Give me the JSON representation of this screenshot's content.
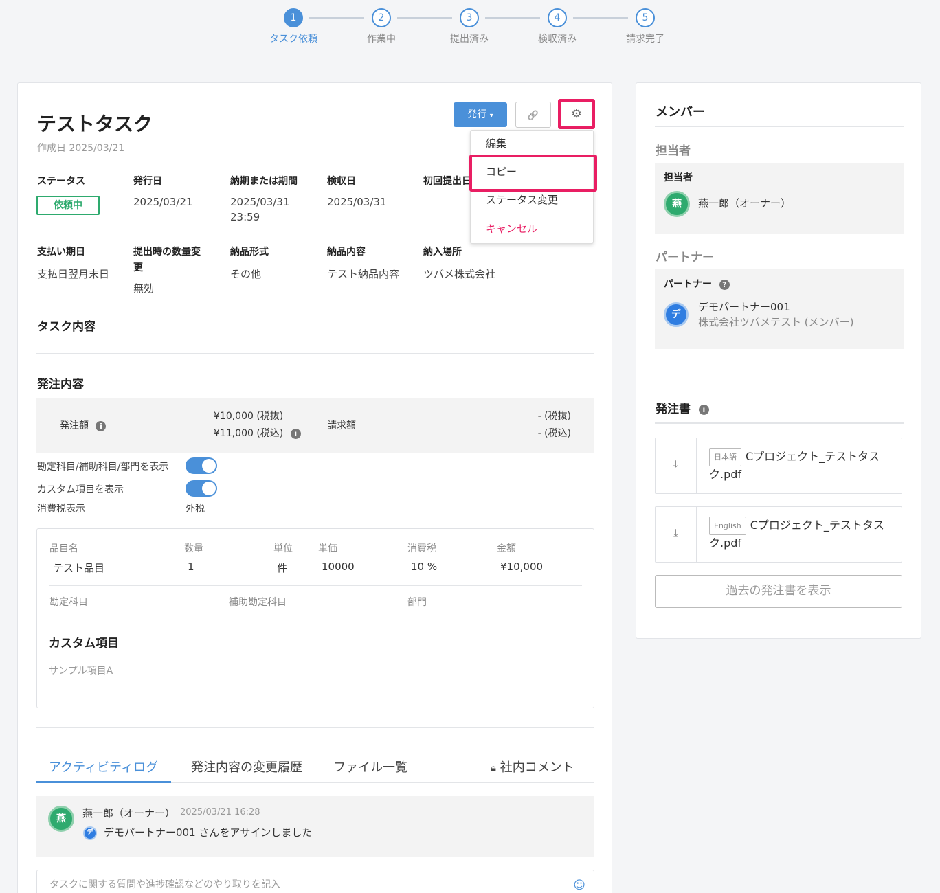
{
  "stepper": {
    "steps": [
      {
        "num": "1",
        "label": "タスク依頼"
      },
      {
        "num": "2",
        "label": "作業中"
      },
      {
        "num": "3",
        "label": "提出済み"
      },
      {
        "num": "4",
        "label": "検収済み"
      },
      {
        "num": "5",
        "label": "請求完了"
      }
    ],
    "active_step": 1
  },
  "task": {
    "title": "テストタスク",
    "created": "作成日 2025/03/21"
  },
  "toolbar": {
    "issue_label": "発行",
    "issue_caret": "▾",
    "link_icon": "🔗",
    "gear_icon": "⚙"
  },
  "menu": {
    "items": [
      "編集",
      "コピー",
      "ステータス変更",
      "キャンセル"
    ]
  },
  "fields": {
    "status_label": "ステータス",
    "status_value": "依頼中",
    "issue_date_label": "発行日",
    "issue_date": "2025/03/21",
    "deadline_label": "納期または期間",
    "deadline_date": "2025/03/31",
    "deadline_time": "23:59",
    "inspection_label": "検収日",
    "inspection_date": "2025/03/31",
    "first_submit_label": "初回提出日",
    "payment_label": "支払い期日",
    "payment_value": "支払日翌月末日",
    "qty_change_label_1": "提出時の数量変",
    "qty_change_label_2": "更",
    "qty_change_value": "無効",
    "delivery_format_label": "納品形式",
    "delivery_format_value": "その他",
    "delivery_content_label": "納品内容",
    "delivery_content_value": "テスト納品内容",
    "delivery_place_label": "納入場所",
    "delivery_place_value": "ツバメ株式会社"
  },
  "sections": {
    "task_content": "タスク内容",
    "order_content": "発注内容",
    "custom_items": "カスタム項目"
  },
  "amounts": {
    "order_label": "発注額",
    "order_ex_tax": "¥10,000 (税抜)",
    "order_in_tax": "¥11,000 (税込)",
    "invoice_label": "請求額",
    "invoice_ex_tax": "- (税抜)",
    "invoice_in_tax": "- (税込)"
  },
  "toggles": {
    "account_label": "勘定科目/補助科目/部門を表示",
    "account_on": true,
    "custom_label": "カスタム項目を表示",
    "custom_on": true,
    "tax_label": "消費税表示",
    "tax_value": "外税"
  },
  "items_table": {
    "headers": [
      "品目名",
      "数量",
      "単位",
      "単価",
      "消費税",
      "金額"
    ],
    "row": [
      "テスト品目",
      "1",
      "件",
      "10000",
      "10 %",
      "¥10,000"
    ],
    "account_headers": [
      "勘定科目",
      "補助勘定科目",
      "部門"
    ],
    "custom_sample": "サンプル項目A"
  },
  "tabs": [
    "アクティビティログ",
    "発注内容の変更履歴",
    "ファイル一覧",
    "社内コメント"
  ],
  "activity": {
    "user": "燕一郎（オーナー）",
    "avatar_char": "燕",
    "time": "2025/03/21 16:28",
    "partner_avatar_char": "デ",
    "message": "デモパートナー001 さんをアサインしました"
  },
  "comment": {
    "placeholder": "タスクに関する質問や進捗確認などのやり取りを記入",
    "emoji_icon": "☺"
  },
  "sidebar": {
    "members_title": "メンバー",
    "assignee_section": "担当者",
    "assignee_box_label": "担当者",
    "assignee_avatar": "燕",
    "assignee_name": "燕一郎（オーナー）",
    "partner_section": "パートナー",
    "partner_box_label": "パートナー",
    "partner_avatar": "デ",
    "partner_name": "デモパートナー001",
    "partner_company": "株式会社ツバメテスト (メンバー)",
    "po_title": "発注書",
    "files": [
      {
        "lang": "日本語",
        "name": "Cプロジェクト_テストタスク.pdf"
      },
      {
        "lang": "English",
        "name": "Cプロジェクト_テストタスク.pdf"
      }
    ],
    "past_button": "過去の発注書を表示"
  },
  "colors": {
    "accent": "#4a90d9",
    "highlight": "#e91e63",
    "status_green": "#2eaa6e"
  }
}
